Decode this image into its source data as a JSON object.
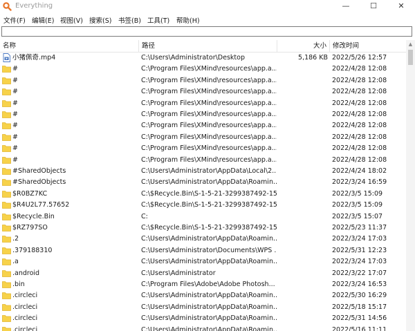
{
  "window": {
    "title": "Everything",
    "controls": {
      "minimize": "—",
      "maximize": "☐",
      "close": "✕"
    }
  },
  "menu": [
    "文件(F)",
    "编辑(E)",
    "视图(V)",
    "搜索(S)",
    "书签(B)",
    "工具(T)",
    "帮助(H)"
  ],
  "search": {
    "value": "",
    "placeholder": ""
  },
  "columns": {
    "name": "名称",
    "path": "路径",
    "size": "大小",
    "date": "修改时间"
  },
  "rows": [
    {
      "icon": "video-file-icon",
      "name": "小猪佩奇.mp4",
      "path": "C:\\Users\\Administrator\\Desktop",
      "size": "5,186 KB",
      "date": "2022/5/26 12:57"
    },
    {
      "icon": "folder-icon",
      "name": "#",
      "path": "C:\\Program Files\\XMind\\resources\\app.a...",
      "size": "",
      "date": "2022/4/28 12:08"
    },
    {
      "icon": "folder-icon",
      "name": "#",
      "path": "C:\\Program Files\\XMind\\resources\\app.a...",
      "size": "",
      "date": "2022/4/28 12:08"
    },
    {
      "icon": "folder-icon",
      "name": "#",
      "path": "C:\\Program Files\\XMind\\resources\\app.a...",
      "size": "",
      "date": "2022/4/28 12:08"
    },
    {
      "icon": "folder-icon",
      "name": "#",
      "path": "C:\\Program Files\\XMind\\resources\\app.a...",
      "size": "",
      "date": "2022/4/28 12:08"
    },
    {
      "icon": "folder-icon",
      "name": "#",
      "path": "C:\\Program Files\\XMind\\resources\\app.a...",
      "size": "",
      "date": "2022/4/28 12:08"
    },
    {
      "icon": "folder-icon",
      "name": "#",
      "path": "C:\\Program Files\\XMind\\resources\\app.a...",
      "size": "",
      "date": "2022/4/28 12:08"
    },
    {
      "icon": "folder-icon",
      "name": "#",
      "path": "C:\\Program Files\\XMind\\resources\\app.a...",
      "size": "",
      "date": "2022/4/28 12:08"
    },
    {
      "icon": "folder-icon",
      "name": "#",
      "path": "C:\\Program Files\\XMind\\resources\\app.a...",
      "size": "",
      "date": "2022/4/28 12:08"
    },
    {
      "icon": "folder-icon",
      "name": "#",
      "path": "C:\\Program Files\\XMind\\resources\\app.a...",
      "size": "",
      "date": "2022/4/28 12:08"
    },
    {
      "icon": "folder-icon",
      "name": "#SharedObjects",
      "path": "C:\\Users\\Administrator\\AppData\\Local\\2...",
      "size": "",
      "date": "2022/4/24 18:02"
    },
    {
      "icon": "folder-icon",
      "name": "#SharedObjects",
      "path": "C:\\Users\\Administrator\\AppData\\Roamin...",
      "size": "",
      "date": "2022/3/24 16:59"
    },
    {
      "icon": "folder-icon",
      "name": "$R0BZ7KC",
      "path": "C:\\$Recycle.Bin\\S-1-5-21-3299387492-15...",
      "size": "",
      "date": "2022/3/5 15:09"
    },
    {
      "icon": "folder-icon",
      "name": "$R4U2L77.57652",
      "path": "C:\\$Recycle.Bin\\S-1-5-21-3299387492-15...",
      "size": "",
      "date": "2022/3/5 15:09"
    },
    {
      "icon": "folder-icon",
      "name": "$Recycle.Bin",
      "path": "C:",
      "size": "",
      "date": "2022/3/5 15:07"
    },
    {
      "icon": "folder-icon",
      "name": "$RZ797SO",
      "path": "C:\\$Recycle.Bin\\S-1-5-21-3299387492-15...",
      "size": "",
      "date": "2022/5/23 11:37"
    },
    {
      "icon": "folder-icon",
      "name": ".2",
      "path": "C:\\Users\\Administrator\\AppData\\Roamin...",
      "size": "",
      "date": "2022/3/24 17:03"
    },
    {
      "icon": "folder-icon",
      "name": ".379188310",
      "path": "C:\\Users\\Administrator\\Documents\\WPS ...",
      "size": "",
      "date": "2022/5/31 12:23"
    },
    {
      "icon": "folder-icon",
      "name": ".a",
      "path": "C:\\Users\\Administrator\\AppData\\Roamin...",
      "size": "",
      "date": "2022/3/24 17:03"
    },
    {
      "icon": "folder-icon",
      "name": ".android",
      "path": "C:\\Users\\Administrator",
      "size": "",
      "date": "2022/3/22 17:07"
    },
    {
      "icon": "folder-icon",
      "name": ".bin",
      "path": "C:\\Program Files\\Adobe\\Adobe Photosh...",
      "size": "",
      "date": "2022/3/24 16:53"
    },
    {
      "icon": "folder-icon",
      "name": ".circleci",
      "path": "C:\\Users\\Administrator\\AppData\\Roamin...",
      "size": "",
      "date": "2022/5/30 16:29"
    },
    {
      "icon": "folder-icon",
      "name": ".circleci",
      "path": "C:\\Users\\Administrator\\AppData\\Roamin...",
      "size": "",
      "date": "2022/5/18 15:17"
    },
    {
      "icon": "folder-icon",
      "name": ".circleci",
      "path": "C:\\Users\\Administrator\\AppData\\Roamin...",
      "size": "",
      "date": "2022/5/31 14:56"
    },
    {
      "icon": "folder-icon",
      "name": ".circleci",
      "path": "C:\\Users\\Administrator\\AppData\\Roamin...",
      "size": "",
      "date": "2022/5/16 11:11"
    }
  ],
  "colors": {
    "folder": "#f7d24a",
    "folder_edge": "#e2b530",
    "accent": "#e8762b"
  },
  "scrollbar": {
    "up": "▲"
  }
}
